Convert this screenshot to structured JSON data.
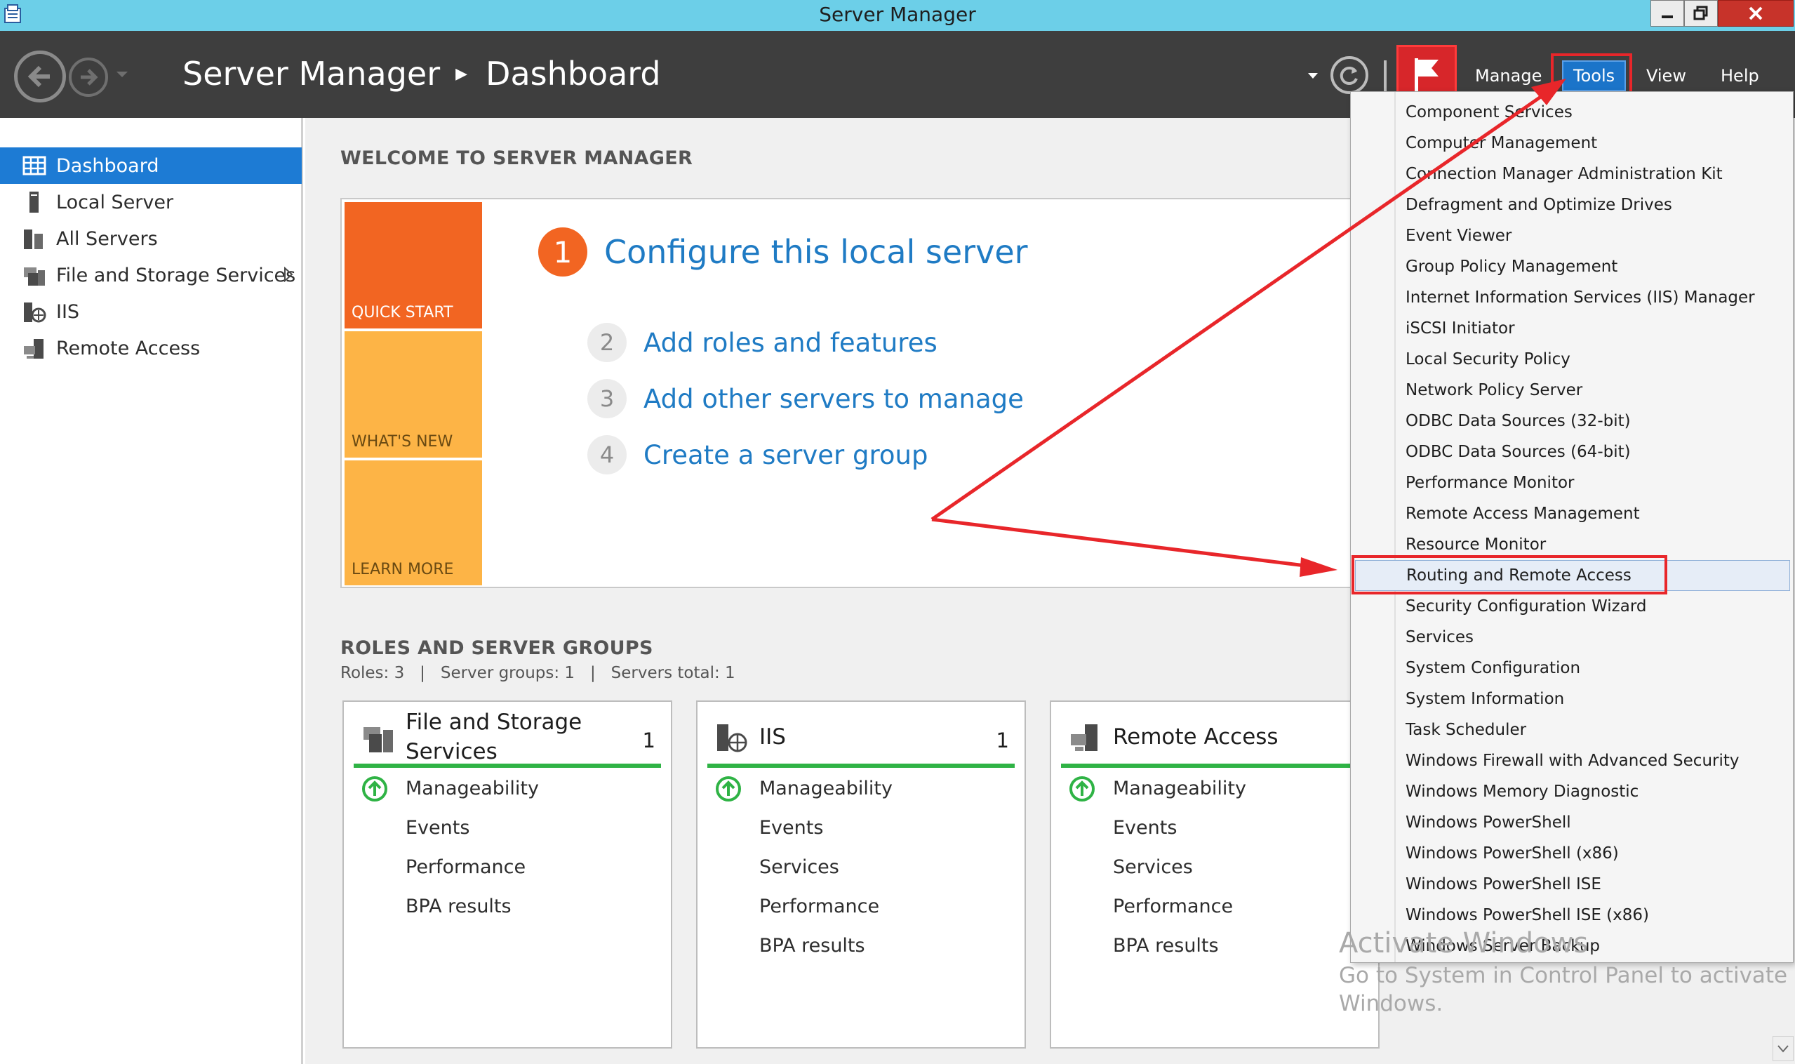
{
  "window": {
    "title": "Server Manager"
  },
  "header": {
    "breadcrumb_root": "Server Manager",
    "breadcrumb_current": "Dashboard",
    "menu": {
      "manage": "Manage",
      "tools": "Tools",
      "view": "View",
      "help": "Help"
    }
  },
  "sidebar": {
    "items": [
      {
        "label": "Dashboard",
        "icon": "dashboard-icon",
        "active": true
      },
      {
        "label": "Local Server",
        "icon": "server-icon"
      },
      {
        "label": "All Servers",
        "icon": "servers-icon"
      },
      {
        "label": "File and Storage Services",
        "icon": "file-storage-icon"
      },
      {
        "label": "IIS",
        "icon": "iis-icon"
      },
      {
        "label": "Remote Access",
        "icon": "remote-access-icon"
      }
    ]
  },
  "welcome": {
    "title": "WELCOME TO SERVER MANAGER",
    "tiles": {
      "quick_start": "QUICK START",
      "whats_new": "WHAT'S NEW",
      "learn_more": "LEARN MORE"
    },
    "steps": [
      {
        "num": "1",
        "label": "Configure this local server"
      },
      {
        "num": "2",
        "label": "Add roles and features"
      },
      {
        "num": "3",
        "label": "Add other servers to manage"
      },
      {
        "num": "4",
        "label": "Create a server group"
      }
    ]
  },
  "roles": {
    "title": "ROLES AND SERVER GROUPS",
    "summary": "Roles: 3   |   Server groups: 1   |   Servers total: 1",
    "cards": [
      {
        "name": "File and Storage Services",
        "count": "1",
        "rows": [
          "Manageability",
          "Events",
          "Performance",
          "BPA results"
        ]
      },
      {
        "name": "IIS",
        "count": "1",
        "rows": [
          "Manageability",
          "Events",
          "Services",
          "Performance",
          "BPA results"
        ]
      },
      {
        "name": "Remote Access",
        "count": "",
        "rows": [
          "Manageability",
          "Events",
          "Services",
          "Performance",
          "BPA results"
        ]
      }
    ]
  },
  "tools_menu": {
    "items": [
      "Component Services",
      "Computer Management",
      "Connection Manager Administration Kit",
      "Defragment and Optimize Drives",
      "Event Viewer",
      "Group Policy Management",
      "Internet Information Services (IIS) Manager",
      "iSCSI Initiator",
      "Local Security Policy",
      "Network Policy Server",
      "ODBC Data Sources (32-bit)",
      "ODBC Data Sources (64-bit)",
      "Performance Monitor",
      "Remote Access Management",
      "Resource Monitor",
      "Routing and Remote Access",
      "Security Configuration Wizard",
      "Services",
      "System Configuration",
      "System Information",
      "Task Scheduler",
      "Windows Firewall with Advanced Security",
      "Windows Memory Diagnostic",
      "Windows PowerShell",
      "Windows PowerShell (x86)",
      "Windows PowerShell ISE",
      "Windows PowerShell ISE (x86)",
      "Windows Server Backup"
    ],
    "highlighted": "Routing and Remote Access"
  },
  "watermark": {
    "line1": "Activate Windows",
    "line2": "Go to System in Control Panel to activate",
    "line3": "Windows."
  },
  "colors": {
    "titlebar": "#6ccfe8",
    "header": "#3e3e3e",
    "accent_blue": "#1d7bd4",
    "quick_start": "#f26522",
    "tile_yellow": "#fdb446",
    "status_green": "#2fb345",
    "annotation_red": "#e8262a"
  }
}
